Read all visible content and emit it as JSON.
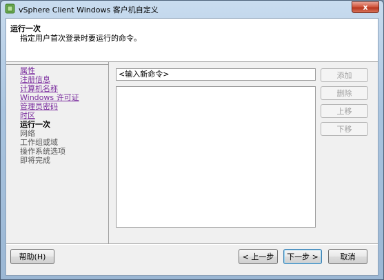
{
  "window": {
    "title": "vSphere Client Windows 客户机自定义",
    "close_label": "x"
  },
  "header": {
    "title": "运行一次",
    "subtitle": "指定用户首次登录时要运行的命令。"
  },
  "nav": {
    "items": [
      {
        "label": "属性",
        "state": "done"
      },
      {
        "label": "注册信息",
        "state": "done"
      },
      {
        "label": "计算机名称",
        "state": "done"
      },
      {
        "label": "Windows 许可证",
        "state": "done"
      },
      {
        "label": "管理员密码",
        "state": "done"
      },
      {
        "label": "时区",
        "state": "done"
      },
      {
        "label": "运行一次",
        "state": "current"
      },
      {
        "label": "网络",
        "state": "pending"
      },
      {
        "label": "工作组或域",
        "state": "pending"
      },
      {
        "label": "操作系统选项",
        "state": "pending"
      },
      {
        "label": "即将完成",
        "state": "pending"
      }
    ]
  },
  "command": {
    "input_value": "<输入新命令>",
    "list_items": []
  },
  "side_buttons": {
    "add": "添加",
    "delete": "删除",
    "move_up": "上移",
    "move_down": "下移"
  },
  "footer": {
    "help": "帮助(H)",
    "back": "< 上一步",
    "next": "下一步 >",
    "cancel": "取消"
  },
  "colors": {
    "link_visited": "#7a2b9e",
    "disabled_text": "#a0a0a0",
    "close_red": "#c9462c"
  }
}
